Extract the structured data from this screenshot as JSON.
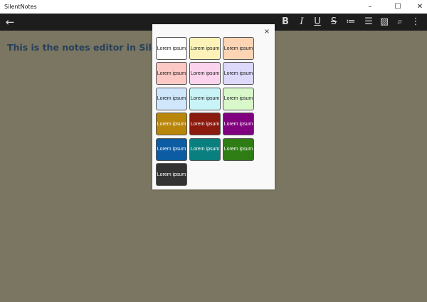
{
  "window": {
    "title": "SilentNotes",
    "minimize": "–",
    "maximize": "☐",
    "close": "✕"
  },
  "toolbar": {
    "back": "←",
    "bold": "B",
    "italic": "I",
    "underline": "U",
    "strikethrough": "S̶",
    "ordered_list": "≔",
    "bullet_list": "☰",
    "no_image": "▨",
    "search": "⌕",
    "more": "⋮"
  },
  "editor": {
    "heading": "This is the notes editor in SilentNotes"
  },
  "dialog": {
    "close": "×",
    "tiles": [
      {
        "label": "Lorem ipsum",
        "bg": "#ffffff",
        "fg": "#222222"
      },
      {
        "label": "Lorem ipsum",
        "bg": "#fdf3b8",
        "fg": "#222222"
      },
      {
        "label": "Lorem ipsum",
        "bg": "#fdd5b5",
        "fg": "#222222"
      },
      {
        "label": "Lorem ipsum",
        "bg": "#fcc9c4",
        "fg": "#222222"
      },
      {
        "label": "Lorem ipsum",
        "bg": "#fcd3ec",
        "fg": "#222222"
      },
      {
        "label": "Lorem ipsum",
        "bg": "#dcd9fb",
        "fg": "#222222"
      },
      {
        "label": "Lorem ipsum",
        "bg": "#cfe6fb",
        "fg": "#222222"
      },
      {
        "label": "Lorem ipsum",
        "bg": "#c9f4f7",
        "fg": "#222222"
      },
      {
        "label": "Lorem ipsum",
        "bg": "#d9f8ca",
        "fg": "#222222"
      },
      {
        "label": "Lorem ipsum",
        "bg": "#b8860b",
        "fg": "#ffffff"
      },
      {
        "label": "Lorem ipsum",
        "bg": "#8b1a0e",
        "fg": "#ffffff"
      },
      {
        "label": "Lorem ipsum",
        "bg": "#800080",
        "fg": "#ffffff"
      },
      {
        "label": "Lorem ipsum",
        "bg": "#0b5ca2",
        "fg": "#ffffff"
      },
      {
        "label": "Lorem ipsum",
        "bg": "#0a7f80",
        "fg": "#ffffff"
      },
      {
        "label": "Lorem ipsum",
        "bg": "#2e7d14",
        "fg": "#ffffff"
      },
      {
        "label": "Lorem ipsum",
        "bg": "#333333",
        "fg": "#ffffff"
      }
    ]
  }
}
